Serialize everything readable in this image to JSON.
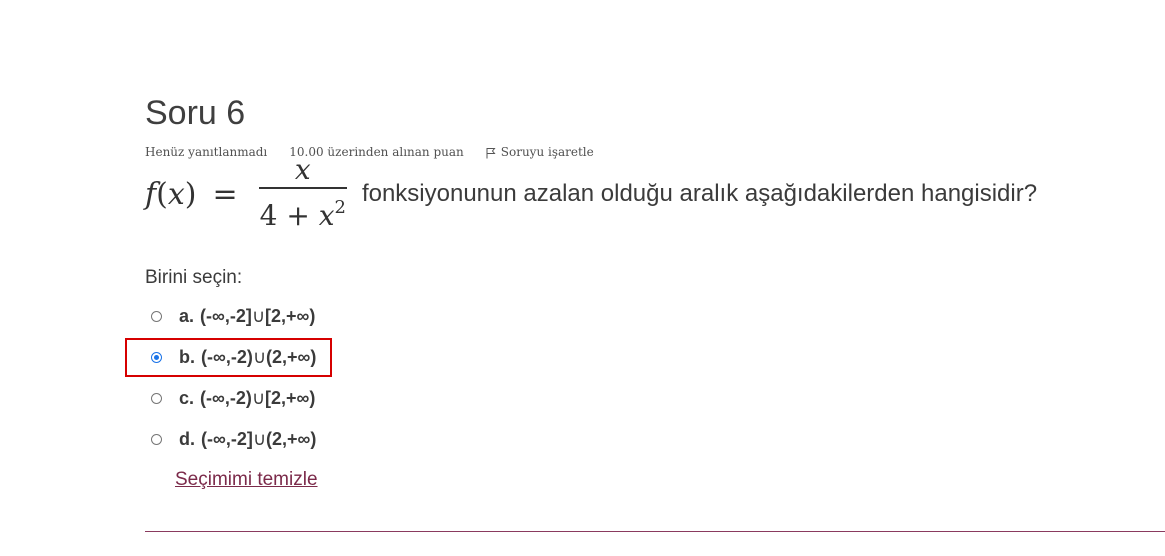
{
  "question": {
    "title": "Soru 6",
    "state": "Henüz yanıtlanmadı",
    "grade": "10.00 üzerinden alınan puan",
    "flag_label": "Soruyu işaretle",
    "formula": {
      "func": "f",
      "var": "x",
      "equals": "=",
      "numerator": "x",
      "denominator_const": "4 + ",
      "denominator_var": "x",
      "denominator_exp": "2"
    },
    "text": "fonksiyonunun azalan olduğu aralık  aşağıdakilerden hangisidir?"
  },
  "prompt": "Birini seçin:",
  "answers": [
    {
      "letter": "a.",
      "left": "(-∞,-2]",
      "cup": "∪",
      "right": "[2,+∞)",
      "checked": false
    },
    {
      "letter": "b.",
      "left": "(-∞,-2)",
      "cup": "∪",
      "right": "(2,+∞)",
      "checked": true
    },
    {
      "letter": "c.",
      "left": "(-∞,-2)",
      "cup": "∪",
      "right": "[2,+∞)",
      "checked": false
    },
    {
      "letter": "d.",
      "left": "(-∞,-2]",
      "cup": "∪",
      "right": "(2,+∞)",
      "checked": false
    }
  ],
  "clear_label": "Seçimimi temizle",
  "colors": {
    "link": "#7b2a4a",
    "divider": "#8a3a5e",
    "highlight": "#d60000",
    "radio_checked": "#1a73e8"
  },
  "icons": {
    "flag": "flag-outline-icon"
  }
}
